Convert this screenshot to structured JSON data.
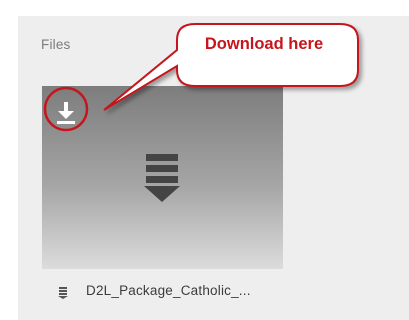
{
  "section": {
    "title": "Files"
  },
  "file": {
    "name": "D2L_Package_Catholic_...",
    "download_icon": "download-tray-icon",
    "type_icon": "stacked-download-icon"
  },
  "annotation": {
    "callout_text": "Download here",
    "callout_color": "#c4161c"
  },
  "colors": {
    "panel_background": "#eeeeee",
    "card_gradient_top": "#7d7d7d",
    "card_gradient_bottom": "#dcdcdc"
  }
}
